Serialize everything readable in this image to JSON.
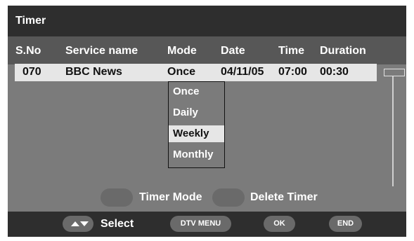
{
  "window": {
    "title": "Timer"
  },
  "table": {
    "headers": {
      "sno": "S.No",
      "service": "Service name",
      "mode": "Mode",
      "date": "Date",
      "time": "Time",
      "duration": "Duration"
    },
    "rows": [
      {
        "sno": "070",
        "service": "BBC News",
        "mode": "Once",
        "date": "04/11/05",
        "time": "07:00",
        "duration": "00:30"
      }
    ]
  },
  "mode_dropdown": {
    "options": [
      "Once",
      "Daily",
      "Weekly",
      "Monthly"
    ],
    "selected": "Weekly"
  },
  "legend": {
    "timer_mode": "Timer Mode",
    "delete_timer": "Delete Timer"
  },
  "footer": {
    "select_label": "Select",
    "dtv_menu": "DTV MENU",
    "ok": "OK",
    "end": "END"
  },
  "icons": {
    "scroll_arrows": "up-down-arrows-icon"
  },
  "colors": {
    "panel": "#7b7b7b",
    "title_bar": "#2e2e2e",
    "header_bar": "#575757",
    "row_highlight": "#e6e6e6",
    "button": "#6a6a6a"
  }
}
